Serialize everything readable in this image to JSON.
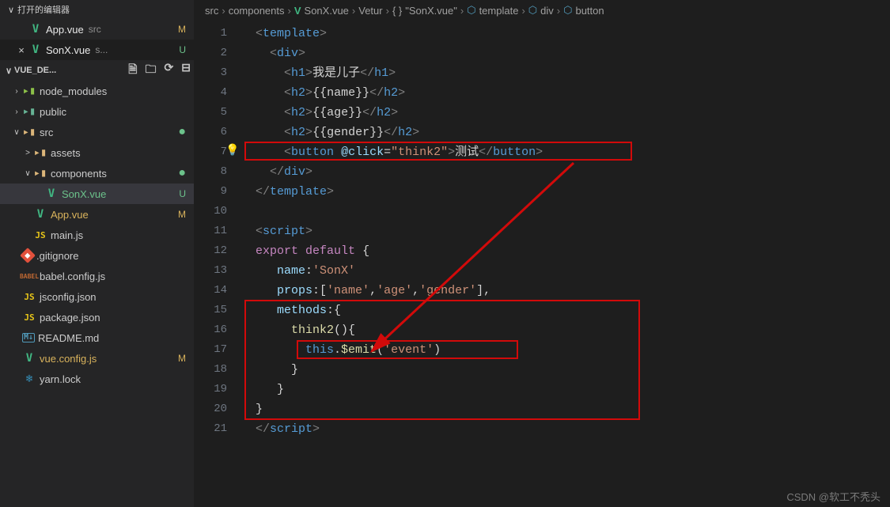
{
  "openEditors": {
    "title": "打开的编辑器",
    "items": [
      {
        "icon": "vue",
        "name": "App.vue",
        "dir": "src",
        "status": "M"
      },
      {
        "icon": "vue",
        "name": "SonX.vue",
        "dir": "s...",
        "status": "U",
        "active": true,
        "closable": true
      }
    ]
  },
  "project": {
    "name": "VUE_DE...",
    "actions": [
      "new-file",
      "new-folder",
      "refresh",
      "collapse"
    ]
  },
  "tree": [
    {
      "d": 1,
      "t": "folder",
      "icon": "nm",
      "name": "node_modules",
      "exp": false
    },
    {
      "d": 1,
      "t": "folder",
      "icon": "pub",
      "name": "public",
      "exp": false
    },
    {
      "d": 1,
      "t": "folder",
      "icon": "o",
      "name": "src",
      "exp": true,
      "dot": true
    },
    {
      "d": 2,
      "t": "folder",
      "icon": "o",
      "name": "assets",
      "exp": false,
      "chev": ">"
    },
    {
      "d": 2,
      "t": "folder",
      "icon": "comp",
      "name": "components",
      "exp": true,
      "dot": true
    },
    {
      "d": 3,
      "t": "file",
      "icon": "vue",
      "name": "SonX.vue",
      "status": "U",
      "sel": true,
      "gitU": true
    },
    {
      "d": 2,
      "t": "file",
      "icon": "vue",
      "name": "App.vue",
      "status": "M",
      "gitM": true
    },
    {
      "d": 2,
      "t": "file",
      "icon": "js",
      "name": "main.js"
    },
    {
      "d": 1,
      "t": "file",
      "icon": "git",
      "name": ".gitignore"
    },
    {
      "d": 1,
      "t": "file",
      "icon": "babel",
      "name": "babel.config.js"
    },
    {
      "d": 1,
      "t": "file",
      "icon": "json",
      "name": "jsconfig.json"
    },
    {
      "d": 1,
      "t": "file",
      "icon": "json",
      "name": "package.json"
    },
    {
      "d": 1,
      "t": "file",
      "icon": "md",
      "name": "README.md"
    },
    {
      "d": 1,
      "t": "file",
      "icon": "vue",
      "name": "vue.config.js",
      "status": "M",
      "gitM": true
    },
    {
      "d": 1,
      "t": "file",
      "icon": "yarn",
      "name": "yarn.lock"
    }
  ],
  "breadcrumbs": [
    {
      "label": "src"
    },
    {
      "label": "components"
    },
    {
      "label": "SonX.vue",
      "icon": "vue"
    },
    {
      "label": "Vetur"
    },
    {
      "label": "\"SonX.vue\"",
      "icon": "brace"
    },
    {
      "label": "template",
      "icon": "cube"
    },
    {
      "label": "div",
      "icon": "cube"
    },
    {
      "label": "button",
      "icon": "cube"
    }
  ],
  "lineCount": 21,
  "code": {
    "h1_text": "我是儿子",
    "btn_text": "测试",
    "name_bind": "name",
    "age_bind": "age",
    "gender_bind": "gender",
    "click_handler": "think2",
    "component_name": "SonX",
    "props": "['name','age','gender']",
    "method_name": "think2",
    "emit_event": "event"
  },
  "watermark": "CSDN @软工不秃头"
}
